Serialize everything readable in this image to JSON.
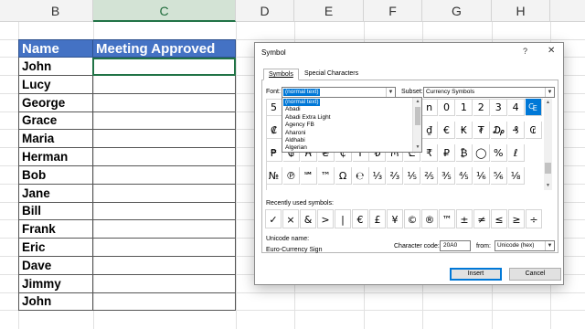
{
  "sheet": {
    "columns": [
      "B",
      "C",
      "D",
      "E",
      "F",
      "G",
      "H"
    ],
    "active_column": "C",
    "header": {
      "name": "Name",
      "approved": "Meeting Approved"
    },
    "names": [
      "John",
      "Lucy",
      "George",
      "Grace",
      "Maria",
      "Herman",
      "Bob",
      "Jane",
      "Bill",
      "Frank",
      "Eric",
      "Dave",
      "Jimmy",
      "John"
    ]
  },
  "dialog": {
    "title": "Symbol",
    "help_icon": "?",
    "close_icon": "✕",
    "tabs": [
      {
        "label": "Symbols",
        "active": true
      },
      {
        "label": "Special Characters",
        "active": false
      }
    ],
    "font_label": "Font:",
    "font_value": "(normal text)",
    "subset_label": "Subset:",
    "subset_value": "Currency Symbols",
    "font_list": [
      "(normal text)",
      "Abadi",
      "Abadi Extra Light",
      "Agency FB",
      "Aharoni",
      "Aldhabi",
      "Algerian"
    ],
    "symbol_grid": [
      [
        "5",
        "",
        "",
        "",
        "",
        "",
        "=",
        "(",
        ")",
        "n",
        "0",
        "1",
        "2",
        "3",
        "4",
        "₠"
      ],
      [
        "₡",
        "",
        "",
        "",
        "",
        "",
        "₨",
        "₩",
        "₪",
        "₫",
        "€",
        "₭",
        "₮",
        "₯",
        "₰",
        "₢"
      ],
      [
        "₱",
        "₲",
        "₳",
        "₴",
        "₵",
        "₸",
        "₺",
        "₼",
        "₾",
        "₹",
        "₽",
        "₿",
        "◯",
        "%",
        "ℓ"
      ],
      [
        "№",
        "℗",
        "℠",
        "™",
        "Ω",
        "℮",
        "⅓",
        "⅔",
        "⅕",
        "⅖",
        "⅗",
        "⅘",
        "⅙",
        "⅚",
        "⅛"
      ]
    ],
    "selected_symbol": "₠",
    "recent_label": "Recently used symbols:",
    "recent_symbols": [
      "✓",
      "×",
      "&",
      ">",
      "|",
      "€",
      "£",
      "¥",
      "©",
      "®",
      "™",
      "±",
      "≠",
      "≤",
      "≥",
      "÷"
    ],
    "unicode_name_label": "Unicode name:",
    "unicode_name": "Euro-Currency Sign",
    "char_code_label": "Character code:",
    "char_code": "20A0",
    "from_label": "from:",
    "from_value": "Unicode (hex)",
    "insert_label": "Insert",
    "cancel_label": "Cancel"
  }
}
